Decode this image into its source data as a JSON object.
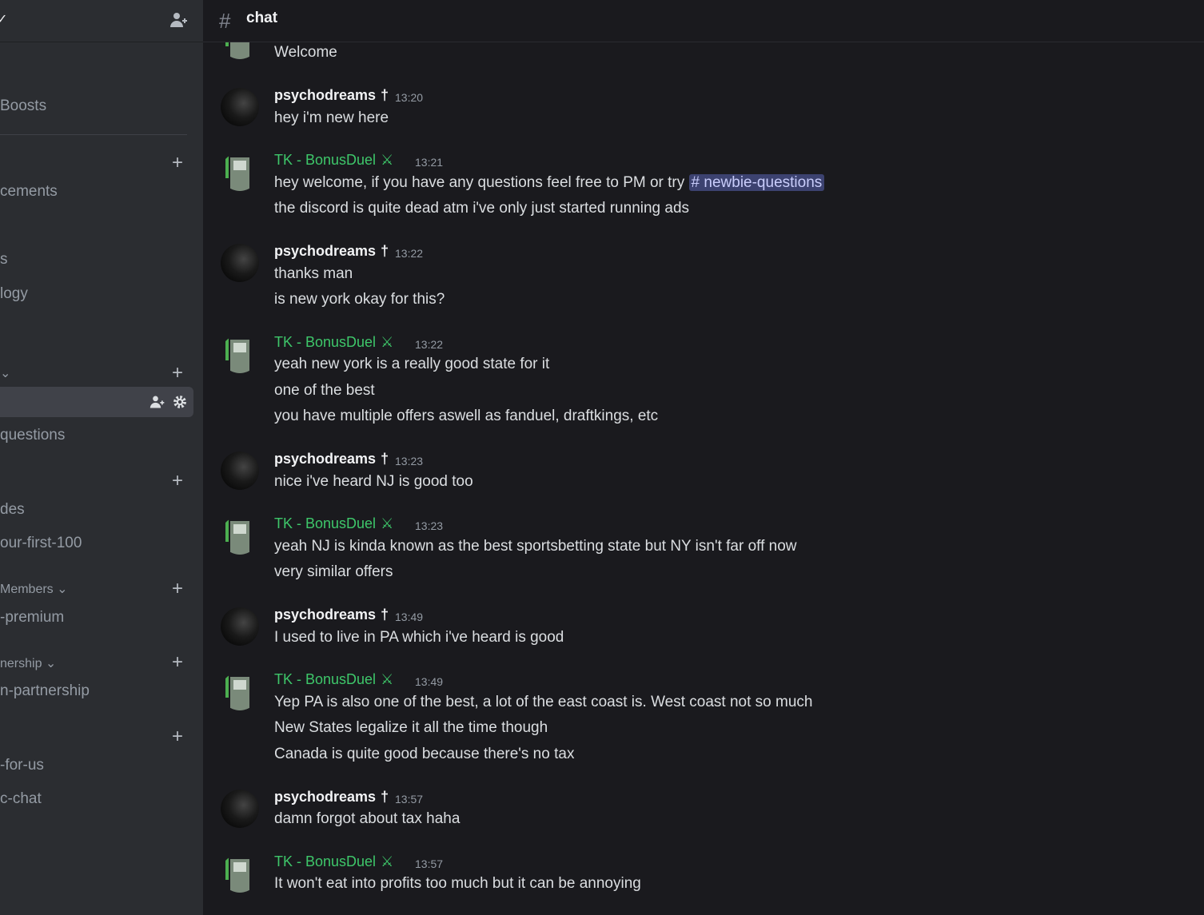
{
  "sidebar": {
    "items": [
      {
        "label": "Boosts"
      },
      {
        "label": "cements"
      },
      {
        "label": "s"
      },
      {
        "label": "logy"
      },
      {
        "label": "questions"
      },
      {
        "label": "des"
      },
      {
        "label": "our-first-100"
      },
      {
        "label": "-premium"
      },
      {
        "label": "n-partnership"
      },
      {
        "label": "-for-us"
      },
      {
        "label": "c-chat"
      }
    ],
    "categories": [
      {
        "label": "Members"
      },
      {
        "label": "nership"
      }
    ]
  },
  "channel": {
    "title": "chat"
  },
  "messages": [
    {
      "text": "Welcome"
    },
    {
      "author": "psychodreams",
      "time": "13:20",
      "lines": [
        "hey i'm new here"
      ]
    },
    {
      "author": "TK - BonusDuel",
      "time": "13:21",
      "lines": [
        "hey welcome, if you have any questions feel free to PM or try",
        "the discord is quite dead atm i've only just started running ads"
      ],
      "mention": "# newbie-questions"
    },
    {
      "author": "psychodreams",
      "time": "13:22",
      "lines": [
        "thanks man",
        "is new york okay for this?"
      ]
    },
    {
      "author": "TK - BonusDuel",
      "time": "13:22",
      "lines": [
        "yeah new york is a really good state for it",
        "one of the best",
        "you have multiple offers aswell as fanduel, draftkings, etc"
      ]
    },
    {
      "author": "psychodreams",
      "time": "13:23",
      "lines": [
        "nice i've heard NJ is good too"
      ]
    },
    {
      "author": "TK - BonusDuel",
      "time": "13:23",
      "lines": [
        "yeah NJ is kinda known as the best sportsbetting state but NY isn't far off now",
        "very similar offers"
      ]
    },
    {
      "author": "psychodreams",
      "time": "13:49",
      "lines": [
        "I used to live in PA which i've heard is good"
      ]
    },
    {
      "author": "TK - BonusDuel",
      "time": "13:49",
      "lines": [
        "Yep PA is also one of the best, a lot of the east coast is. West coast not so much",
        "New States legalize it all the time though",
        "Canada is quite good because there's no tax"
      ]
    },
    {
      "author": "psychodreams",
      "time": "13:57",
      "lines": [
        "damn forgot about tax haha"
      ]
    },
    {
      "author": "TK - BonusDuel",
      "time": "13:57",
      "lines": [
        "It won't eat into profits too much but it can be annoying"
      ]
    }
  ]
}
